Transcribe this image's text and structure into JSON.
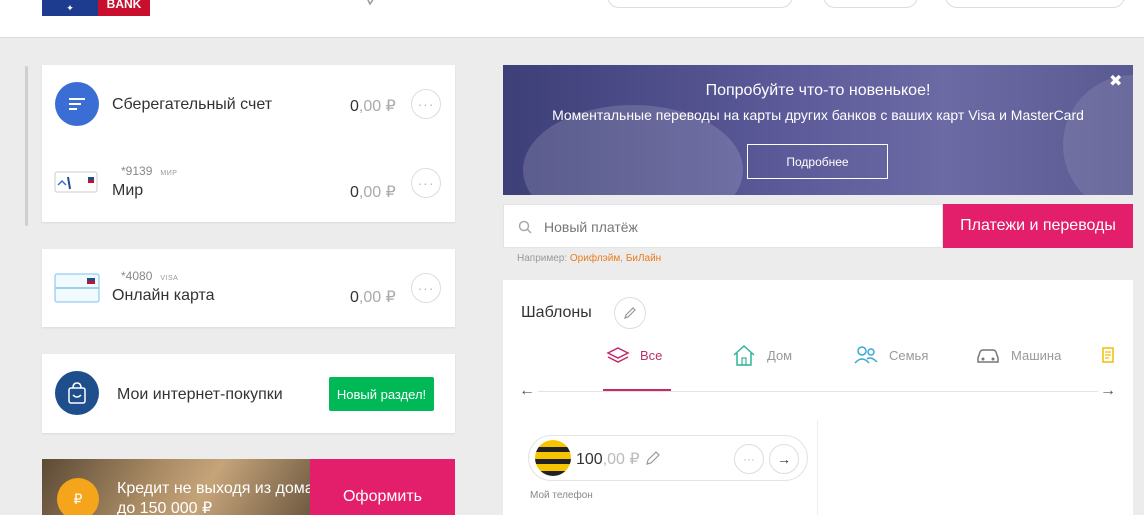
{
  "header": {
    "logo_bank": "BANK"
  },
  "accounts": [
    {
      "name": "Сберегательный счет",
      "amount_int": "0",
      "amount_dec": ",00 ₽",
      "more": "···"
    },
    {
      "number": "*9139",
      "system": "МИР",
      "name": "Мир",
      "amount_int": "0",
      "amount_dec": ",00 ₽",
      "more": "···"
    },
    {
      "number": "*4080",
      "system": "VISA",
      "name": "Онлайн карта",
      "amount_int": "0",
      "amount_dec": ",00 ₽",
      "more": "···"
    }
  ],
  "shopping": {
    "label": "Мои интернет-покупки",
    "badge": "Новый раздел!"
  },
  "credit": {
    "text": "Кредит не выходя из дома до 150 000 ₽",
    "button": "Оформить",
    "coin": "₽"
  },
  "promo": {
    "title": "Попробуйте что-то новенькое!",
    "subtitle": "Моментальные переводы на карты других банков с ваших карт Visa и MasterCard",
    "button": "Подробнее",
    "close": "✖"
  },
  "search": {
    "placeholder": "Новый платёж",
    "button": "Платежи и переводы",
    "example_prefix": "Например:",
    "example_1": "Орифлэйм",
    "example_sep": ",",
    "example_2": "БиЛайн"
  },
  "templates": {
    "title": "Шаблоны",
    "categories": [
      "Все",
      "Дом",
      "Семья",
      "Машина"
    ],
    "active_category": "Все",
    "arrow_left": "←",
    "arrow_right": "→",
    "items": [
      {
        "amount_int": "100",
        "amount_dec": ",00 ₽",
        "label": "Мой телефон",
        "more": "···",
        "go": "→"
      }
    ]
  },
  "colors": {
    "accent_pink": "#e31f6b",
    "badge_green": "#00b956",
    "link_orange": "#e87d1e",
    "icon_blue": "#3b6ed4",
    "icon_navy": "#1f4e8c"
  }
}
